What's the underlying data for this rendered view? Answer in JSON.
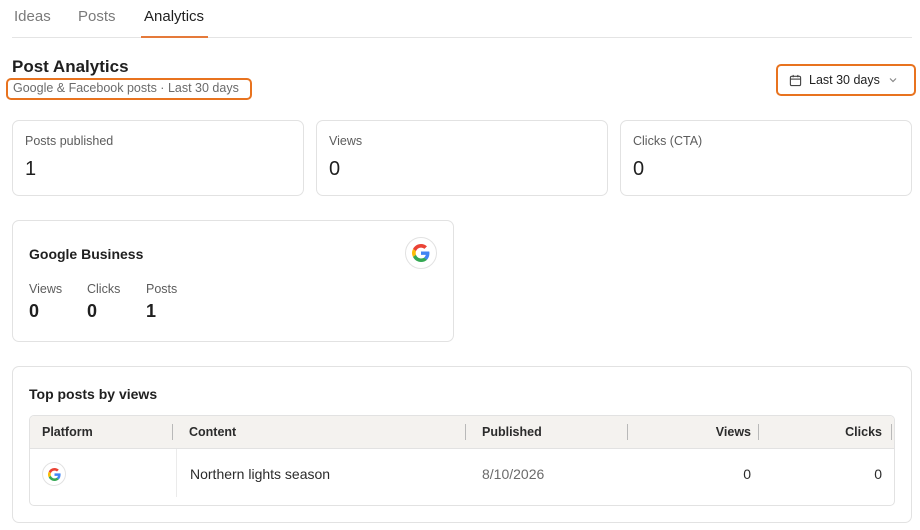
{
  "tabs": [
    {
      "label": "Ideas",
      "active": false
    },
    {
      "label": "Posts",
      "active": false
    },
    {
      "label": "Analytics",
      "active": true
    }
  ],
  "header": {
    "title": "Post Analytics",
    "subtitle": "Google & Facebook posts · Last 30 days"
  },
  "date_range": {
    "label": "Last 30 days",
    "icon": "calendar-icon"
  },
  "stats": [
    {
      "label": "Posts published",
      "value": "1"
    },
    {
      "label": "Views",
      "value": "0"
    },
    {
      "label": "Clicks (CTA)",
      "value": "0"
    }
  ],
  "google_business": {
    "title": "Google Business",
    "icon": "google-logo-icon",
    "metrics": [
      {
        "label": "Views",
        "value": "0"
      },
      {
        "label": "Clicks",
        "value": "0"
      },
      {
        "label": "Posts",
        "value": "1"
      }
    ]
  },
  "top_posts": {
    "title": "Top posts by views",
    "columns": [
      "Platform",
      "Content",
      "Published",
      "Views",
      "Clicks"
    ],
    "rows": [
      {
        "platform_icon": "google-logo-icon",
        "content": "Northern lights season",
        "published": "8/10/2026",
        "views": "0",
        "clicks": "0"
      }
    ]
  },
  "colors": {
    "accent": "#e57a3a",
    "highlight_border": "#e8731f",
    "table_header_bg": "#f4f2ef"
  }
}
